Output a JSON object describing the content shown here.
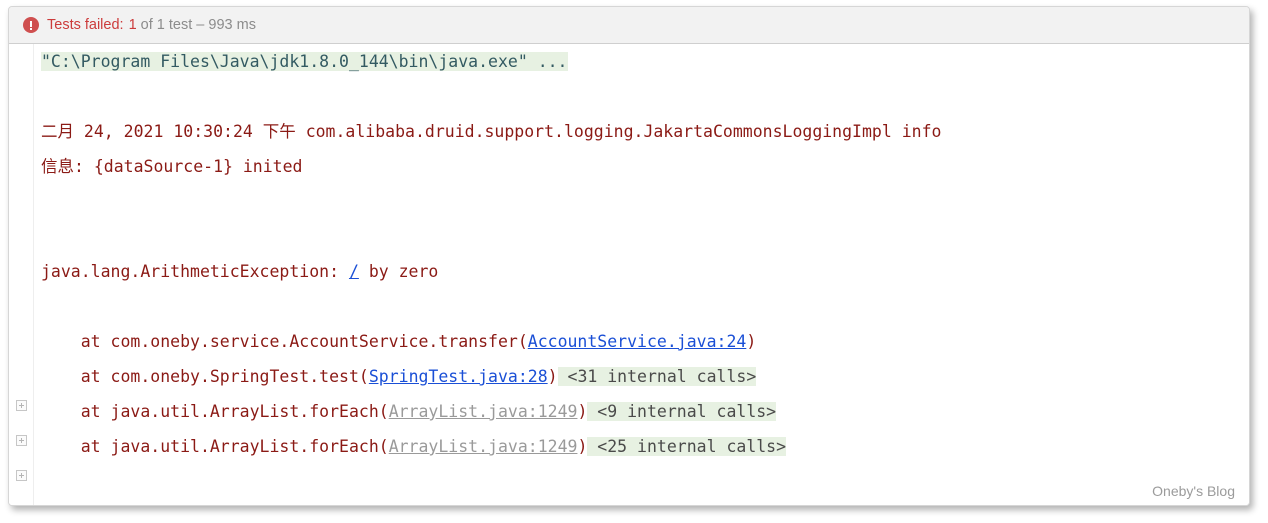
{
  "header": {
    "icon": "error-circle-icon",
    "label": "Tests failed:",
    "count": "1",
    "of_text": " of 1 test – 993 ms"
  },
  "console": {
    "command_line": "\"C:\\Program Files\\Java\\jdk1.8.0_144\\bin\\java.exe\" ...",
    "log": {
      "timestamp": "二月 24, 2021 10:30:24 下午 ",
      "logger": "com.alibaba.druid.support.logging.JakartaCommonsLoggingImpl info",
      "message": "信息: {dataSource-1} inited"
    },
    "exception": {
      "type": "java.lang.ArithmeticException: ",
      "link": "/",
      "tail": " by zero"
    },
    "frames": [
      {
        "prefix": "    at com.oneby.service.AccountService.transfer(",
        "link": "AccountService.java:24",
        "link_style": "source",
        "suffix": ")",
        "internal": "",
        "fold": false
      },
      {
        "prefix": "    at com.oneby.SpringTest.test(",
        "link": "SpringTest.java:28",
        "link_style": "source",
        "suffix": ")",
        "internal": " <31 internal calls>",
        "fold": true
      },
      {
        "prefix": "    at java.util.ArrayList.forEach(",
        "link": "ArrayList.java:1249",
        "link_style": "library",
        "suffix": ")",
        "internal": " <9 internal calls>",
        "fold": true
      },
      {
        "prefix": "    at java.util.ArrayList.forEach(",
        "link": "ArrayList.java:1249",
        "link_style": "library",
        "suffix": ")",
        "internal": " <25 internal calls>",
        "fold": true
      }
    ]
  },
  "watermark": "Oneby's Blog",
  "colors": {
    "error_red": "#cc3b3b",
    "log_maroon": "#8b1a15",
    "command_teal": "#335a62",
    "link_blue": "#1a4fd6",
    "link_muted": "#9a9a9a",
    "highlight_green": "#e7f1e2",
    "header_bg": "#f2f2f2"
  }
}
